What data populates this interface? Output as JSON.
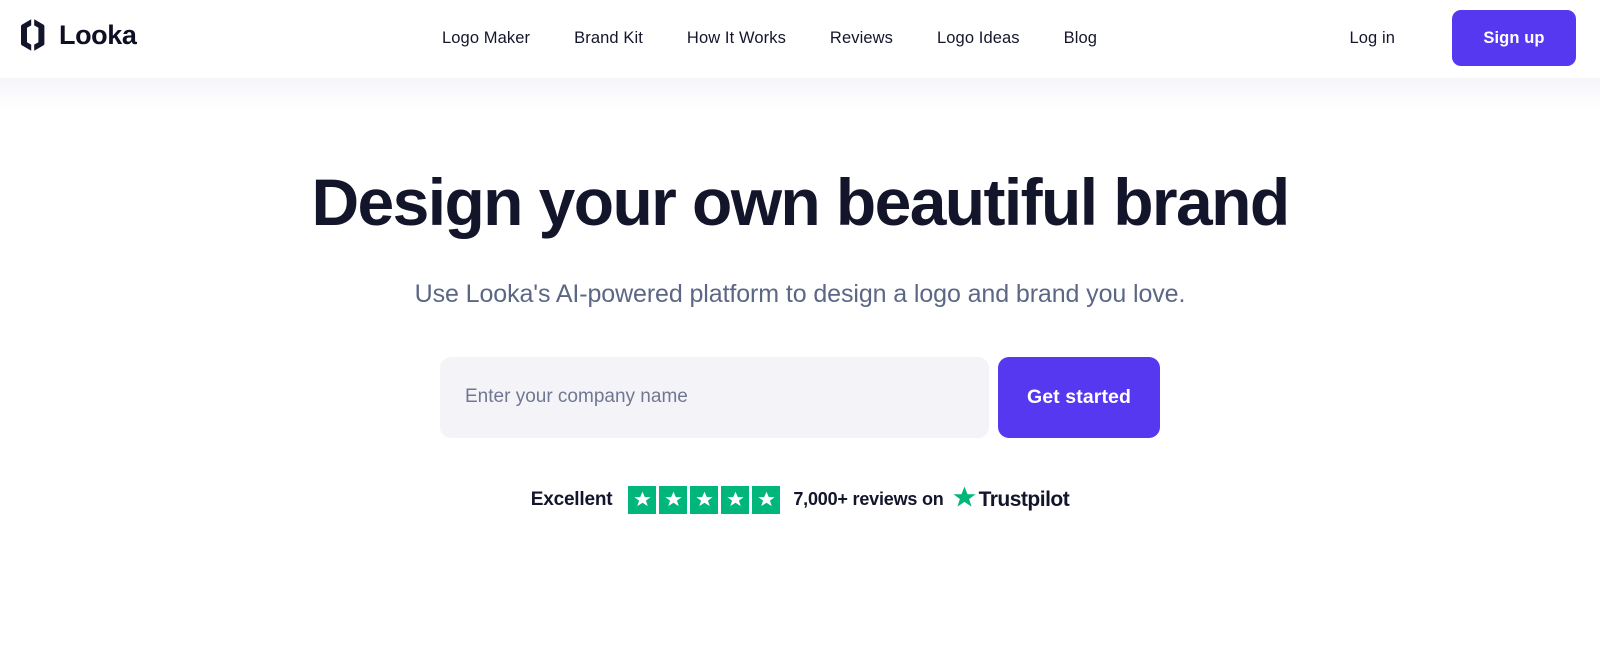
{
  "brand": {
    "name": "Looka",
    "logo_icon": "looka-hexagon-mark"
  },
  "header": {
    "nav_items": [
      {
        "label": "Logo Maker"
      },
      {
        "label": "Brand Kit"
      },
      {
        "label": "How It Works"
      },
      {
        "label": "Reviews"
      },
      {
        "label": "Logo Ideas"
      },
      {
        "label": "Blog"
      }
    ],
    "login_label": "Log in",
    "signup_label": "Sign up"
  },
  "hero": {
    "headline": "Design your own beautiful brand",
    "subheadline": "Use Looka's AI-powered platform to design a logo and brand you love.",
    "input_placeholder": "Enter your company name",
    "input_value": "",
    "cta_label": "Get started"
  },
  "trustpilot": {
    "rating_word": "Excellent",
    "star_count": 5,
    "stars_filled": 5,
    "reviews_text": "7,000+ reviews on",
    "brand_name": "Trustpilot",
    "star_icon": "trustpilot-star-icon"
  },
  "colors": {
    "accent": "#5538F0",
    "ink": "#13152B",
    "muted": "#5B6785",
    "input_bg": "#F4F4F8",
    "trustpilot_green": "#00B67A"
  }
}
